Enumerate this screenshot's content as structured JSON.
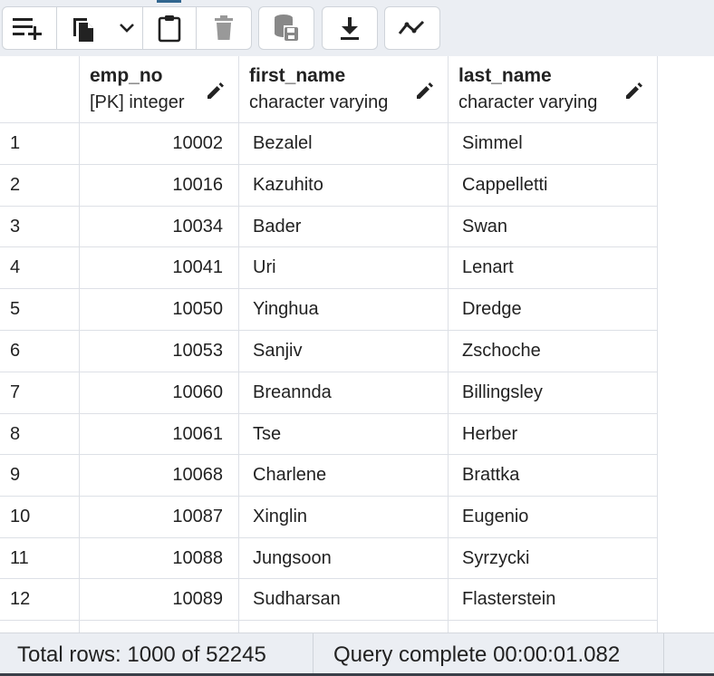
{
  "toolbar": {
    "buttons": [
      {
        "icon": "add-row-icon"
      },
      {
        "icon": "copy-icon"
      },
      {
        "icon": "chevron-down-icon"
      },
      {
        "icon": "paste-icon"
      },
      {
        "icon": "delete-icon"
      },
      {
        "icon": "save-data-icon"
      },
      {
        "icon": "download-icon"
      },
      {
        "icon": "graph-visualiser-icon"
      }
    ]
  },
  "grid": {
    "columns": [
      {
        "name": "emp_no",
        "type": "[PK] integer"
      },
      {
        "name": "first_name",
        "type": "character varying"
      },
      {
        "name": "last_name",
        "type": "character varying"
      }
    ],
    "rows": [
      {
        "num": "1",
        "emp_no": "10002",
        "first_name": "Bezalel",
        "last_name": "Simmel"
      },
      {
        "num": "2",
        "emp_no": "10016",
        "first_name": "Kazuhito",
        "last_name": "Cappelletti"
      },
      {
        "num": "3",
        "emp_no": "10034",
        "first_name": "Bader",
        "last_name": "Swan"
      },
      {
        "num": "4",
        "emp_no": "10041",
        "first_name": "Uri",
        "last_name": "Lenart"
      },
      {
        "num": "5",
        "emp_no": "10050",
        "first_name": "Yinghua",
        "last_name": "Dredge"
      },
      {
        "num": "6",
        "emp_no": "10053",
        "first_name": "Sanjiv",
        "last_name": "Zschoche"
      },
      {
        "num": "7",
        "emp_no": "10060",
        "first_name": "Breannda",
        "last_name": "Billingsley"
      },
      {
        "num": "8",
        "emp_no": "10061",
        "first_name": "Tse",
        "last_name": "Herber"
      },
      {
        "num": "9",
        "emp_no": "10068",
        "first_name": "Charlene",
        "last_name": "Brattka"
      },
      {
        "num": "10",
        "emp_no": "10087",
        "first_name": "Xinglin",
        "last_name": "Eugenio"
      },
      {
        "num": "11",
        "emp_no": "10088",
        "first_name": "Jungsoon",
        "last_name": "Syrzycki"
      },
      {
        "num": "12",
        "emp_no": "10089",
        "first_name": "Sudharsan",
        "last_name": "Flasterstein"
      }
    ]
  },
  "status": {
    "total_rows": "Total rows: 1000 of 52245",
    "query_status": "Query complete 00:00:01.082"
  }
}
